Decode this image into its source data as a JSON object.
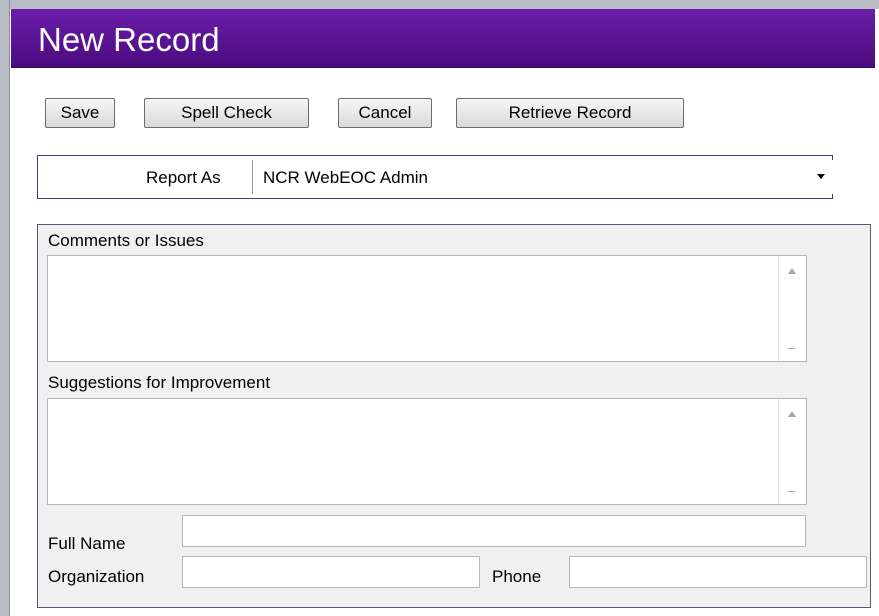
{
  "window": {
    "title": "New Record"
  },
  "toolbar": {
    "save_label": "Save",
    "spell_check_label": "Spell Check",
    "cancel_label": "Cancel",
    "retrieve_label": "Retrieve Record"
  },
  "report_as": {
    "label": "Report As",
    "selected": "NCR WebEOC Admin"
  },
  "form": {
    "comments_label": "Comments or Issues",
    "comments_value": "",
    "suggestions_label": "Suggestions for Improvement",
    "suggestions_value": "",
    "full_name_label": "Full Name",
    "full_name_value": "",
    "organization_label": "Organization",
    "organization_value": "",
    "phone_label": "Phone",
    "phone_value": ""
  },
  "colors": {
    "title_bar": "#5a1494",
    "title_text": "#ffffff",
    "panel_bg": "#f0f0f0",
    "panel_border": "#555a7a"
  },
  "icons": {
    "dropdown": "chevron-down-icon",
    "scroll_up": "scroll-up-icon",
    "scroll_down": "scroll-down-icon"
  }
}
